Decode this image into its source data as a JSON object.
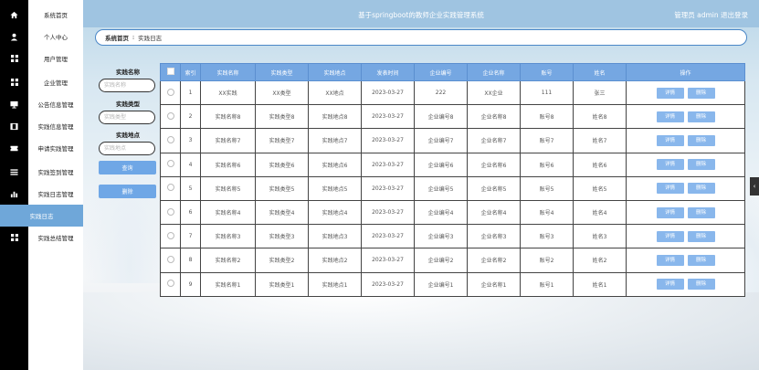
{
  "header": {
    "title": "基于springboot的教师企业实践管理系统",
    "user": "管理员 admin  退出登录"
  },
  "sidebar": {
    "items": [
      {
        "label": "系统首页",
        "icon": "home-icon"
      },
      {
        "label": "个人中心",
        "icon": "user-icon"
      },
      {
        "label": "用户管理",
        "icon": "grid-icon"
      },
      {
        "label": "企业管理",
        "icon": "grid-icon"
      },
      {
        "label": "公告信息管理",
        "icon": "monitor-icon"
      },
      {
        "label": "实践信息管理",
        "icon": "film-icon"
      },
      {
        "label": "申请实践管理",
        "icon": "ticket-icon"
      },
      {
        "label": "实践签到管理",
        "icon": "list-icon"
      },
      {
        "label": "实践日志管理",
        "icon": "bar-chart-icon"
      },
      {
        "label": "实践日志",
        "icon": "",
        "active": true
      },
      {
        "label": "实践总结管理",
        "icon": "grid-icon"
      }
    ]
  },
  "breadcrumb": {
    "home": "系统首页",
    "sep": "⁝",
    "current": "实践日志"
  },
  "search": {
    "name_label": "实践名称",
    "name_placeholder": "实践名称",
    "type_label": "实践类型",
    "type_placeholder": "实践类型",
    "place_label": "实践地点",
    "place_placeholder": "实践地点",
    "query_button": "查询",
    "delete_button": "删除"
  },
  "table": {
    "headers": [
      "索引",
      "实践名称",
      "实践类型",
      "实践地点",
      "发表时间",
      "企业编号",
      "企业名称",
      "账号",
      "姓名",
      "操作"
    ],
    "detail_label": "详情",
    "delete_label": "删除",
    "rows": [
      [
        "1",
        "XX实践",
        "XX类型",
        "XX地点",
        "2023-03-27",
        "222",
        "XX企业",
        "111",
        "张三"
      ],
      [
        "2",
        "实践名称8",
        "实践类型8",
        "实践地点8",
        "2023-03-27",
        "企业编号8",
        "企业名称8",
        "账号8",
        "姓名8"
      ],
      [
        "3",
        "实践名称7",
        "实践类型7",
        "实践地点7",
        "2023-03-27",
        "企业编号7",
        "企业名称7",
        "账号7",
        "姓名7"
      ],
      [
        "4",
        "实践名称6",
        "实践类型6",
        "实践地点6",
        "2023-03-27",
        "企业编号6",
        "企业名称6",
        "账号6",
        "姓名6"
      ],
      [
        "5",
        "实践名称5",
        "实践类型5",
        "实践地点5",
        "2023-03-27",
        "企业编号5",
        "企业名称5",
        "账号5",
        "姓名5"
      ],
      [
        "6",
        "实践名称4",
        "实践类型4",
        "实践地点4",
        "2023-03-27",
        "企业编号4",
        "企业名称4",
        "账号4",
        "姓名4"
      ],
      [
        "7",
        "实践名称3",
        "实践类型3",
        "实践地点3",
        "2023-03-27",
        "企业编号3",
        "企业名称3",
        "账号3",
        "姓名3"
      ],
      [
        "8",
        "实践名称2",
        "实践类型2",
        "实践地点2",
        "2023-03-27",
        "企业编号2",
        "企业名称2",
        "账号2",
        "姓名2"
      ],
      [
        "9",
        "实践名称1",
        "实践类型1",
        "实践地点1",
        "2023-03-27",
        "企业编号1",
        "企业名称1",
        "账号1",
        "姓名1"
      ]
    ]
  },
  "colors": {
    "accent": "#75a7e2",
    "header": "#9fc4e1",
    "active": "#6fa7d9"
  }
}
